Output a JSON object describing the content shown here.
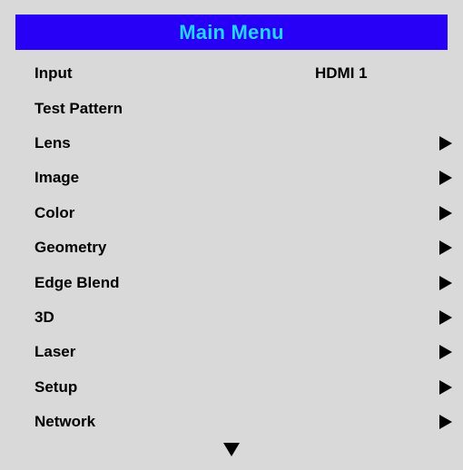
{
  "menu": {
    "title": "Main Menu",
    "colors": {
      "header_bg": "#2800f6",
      "header_text": "#25d4ff",
      "panel_bg": "#d9d9d9",
      "text": "#000000"
    },
    "items": [
      {
        "label": "Input",
        "value": "HDMI 1",
        "has_submenu": false
      },
      {
        "label": "Test Pattern",
        "value": "",
        "has_submenu": false
      },
      {
        "label": "Lens",
        "value": "",
        "has_submenu": true,
        "icon": "triangle-right-icon"
      },
      {
        "label": "Image",
        "value": "",
        "has_submenu": true,
        "icon": "triangle-right-icon"
      },
      {
        "label": "Color",
        "value": "",
        "has_submenu": true,
        "icon": "triangle-right-icon"
      },
      {
        "label": "Geometry",
        "value": "",
        "has_submenu": true,
        "icon": "triangle-right-icon"
      },
      {
        "label": "Edge Blend",
        "value": "",
        "has_submenu": true,
        "icon": "triangle-right-icon"
      },
      {
        "label": "3D",
        "value": "",
        "has_submenu": true,
        "icon": "triangle-right-icon"
      },
      {
        "label": "Laser",
        "value": "",
        "has_submenu": true,
        "icon": "triangle-right-icon"
      },
      {
        "label": "Setup",
        "value": "",
        "has_submenu": true,
        "icon": "triangle-right-icon"
      },
      {
        "label": "Network",
        "value": "",
        "has_submenu": true,
        "icon": "triangle-right-icon"
      }
    ],
    "scroll_indicator": {
      "icon": "triangle-down-icon"
    }
  }
}
